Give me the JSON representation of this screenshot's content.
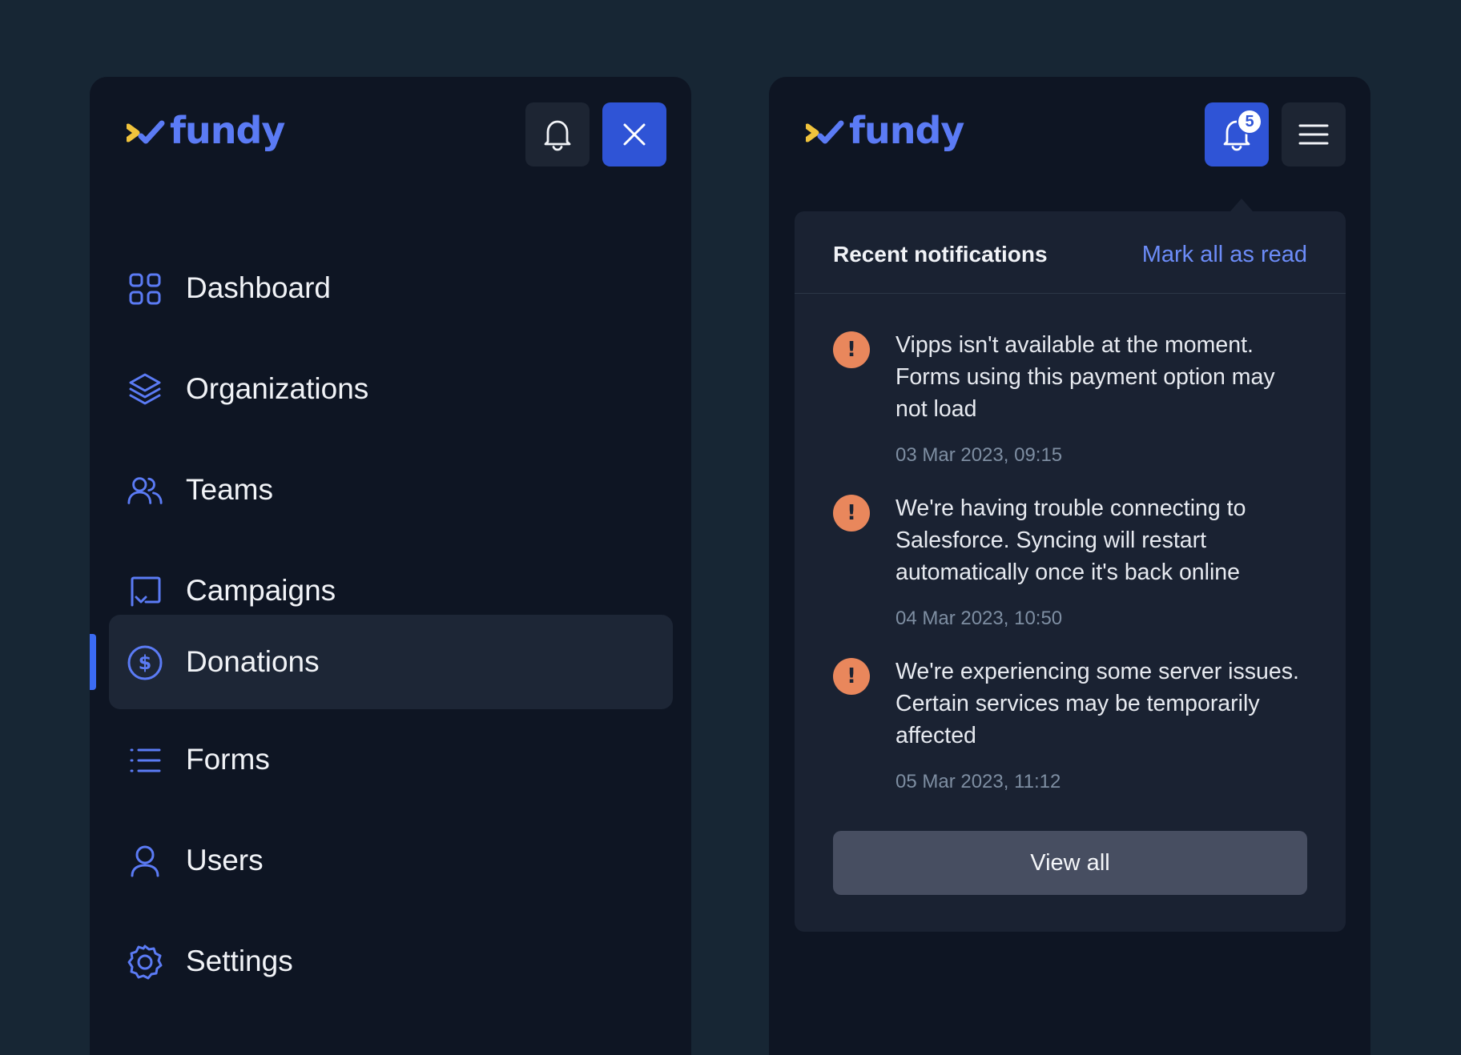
{
  "brand": {
    "name": "fundy",
    "mark_colors": {
      "left": "#f0c33c",
      "right": "#5b7bf5"
    },
    "text_color": "#5b7bf5"
  },
  "left_panel": {
    "header": {
      "notification_icon": "bell-icon",
      "close_icon": "close-icon"
    },
    "nav": {
      "active": "Donations",
      "items": [
        {
          "label": "Dashboard",
          "icon": "dashboard-grid-icon"
        },
        {
          "label": "Organizations",
          "icon": "layers-icon"
        },
        {
          "label": "Teams",
          "icon": "users-group-icon"
        },
        {
          "label": "Campaigns",
          "icon": "campaign-icon"
        },
        {
          "label": "Donations",
          "icon": "dollar-circle-icon"
        },
        {
          "label": "Forms",
          "icon": "list-icon"
        },
        {
          "label": "Users",
          "icon": "user-icon"
        },
        {
          "label": "Settings",
          "icon": "gear-icon"
        }
      ]
    }
  },
  "right_panel": {
    "header": {
      "notification_icon": "bell-icon",
      "notification_count": "5",
      "menu_icon": "hamburger-menu-icon"
    },
    "notifications": {
      "title": "Recent notifications",
      "mark_all_label": "Mark all as read",
      "items": [
        {
          "icon": "warning-icon",
          "message": "Vipps isn't available at the moment. Forms using this payment option may not load",
          "time": "03 Mar 2023, 09:15"
        },
        {
          "icon": "warning-icon",
          "message": "We're having trouble connecting to Salesforce. Syncing will restart automatically once it's back online",
          "time": "04 Mar 2023, 10:50"
        },
        {
          "icon": "warning-icon",
          "message": "We're experiencing some server issues. Certain services may be temporarily affected",
          "time": "05 Mar 2023, 11:12"
        }
      ],
      "view_all_label": "View all"
    }
  },
  "colors": {
    "background": "#172634",
    "panel": "#0e1523",
    "accent": "#2f54d6",
    "icon_blue": "#5b7bf5",
    "warning": "#e9875c",
    "link": "#6c8cf8"
  }
}
